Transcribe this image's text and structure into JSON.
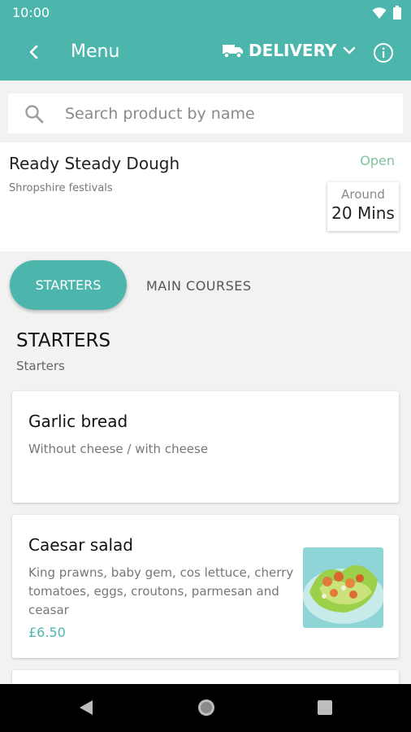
{
  "status_bar": {
    "time": "10:00"
  },
  "app_bar": {
    "title": "Menu",
    "delivery_label": "DELIVERY"
  },
  "search": {
    "placeholder": "Search product by name"
  },
  "store": {
    "name": "Ready Steady Dough",
    "subtitle": "Shropshire festivals",
    "status": "Open",
    "eta_label": "Around",
    "eta_value": "20 Mins"
  },
  "tabs": [
    {
      "label": "STARTERS",
      "active": true
    },
    {
      "label": "MAIN COURSES",
      "active": false
    }
  ],
  "section": {
    "title": "STARTERS",
    "subtitle": "Starters"
  },
  "items": [
    {
      "name": "Garlic bread",
      "description": "Without cheese / with cheese"
    },
    {
      "name": "Caesar salad",
      "description": "King prawns, baby gem, cos lettuce, cherry tomatoes, eggs, croutons, parmesan and ceasar",
      "price": "£6.50"
    }
  ],
  "colors": {
    "accent": "#4db6ac",
    "open": "#7cc49c",
    "price": "#4db6ac"
  }
}
